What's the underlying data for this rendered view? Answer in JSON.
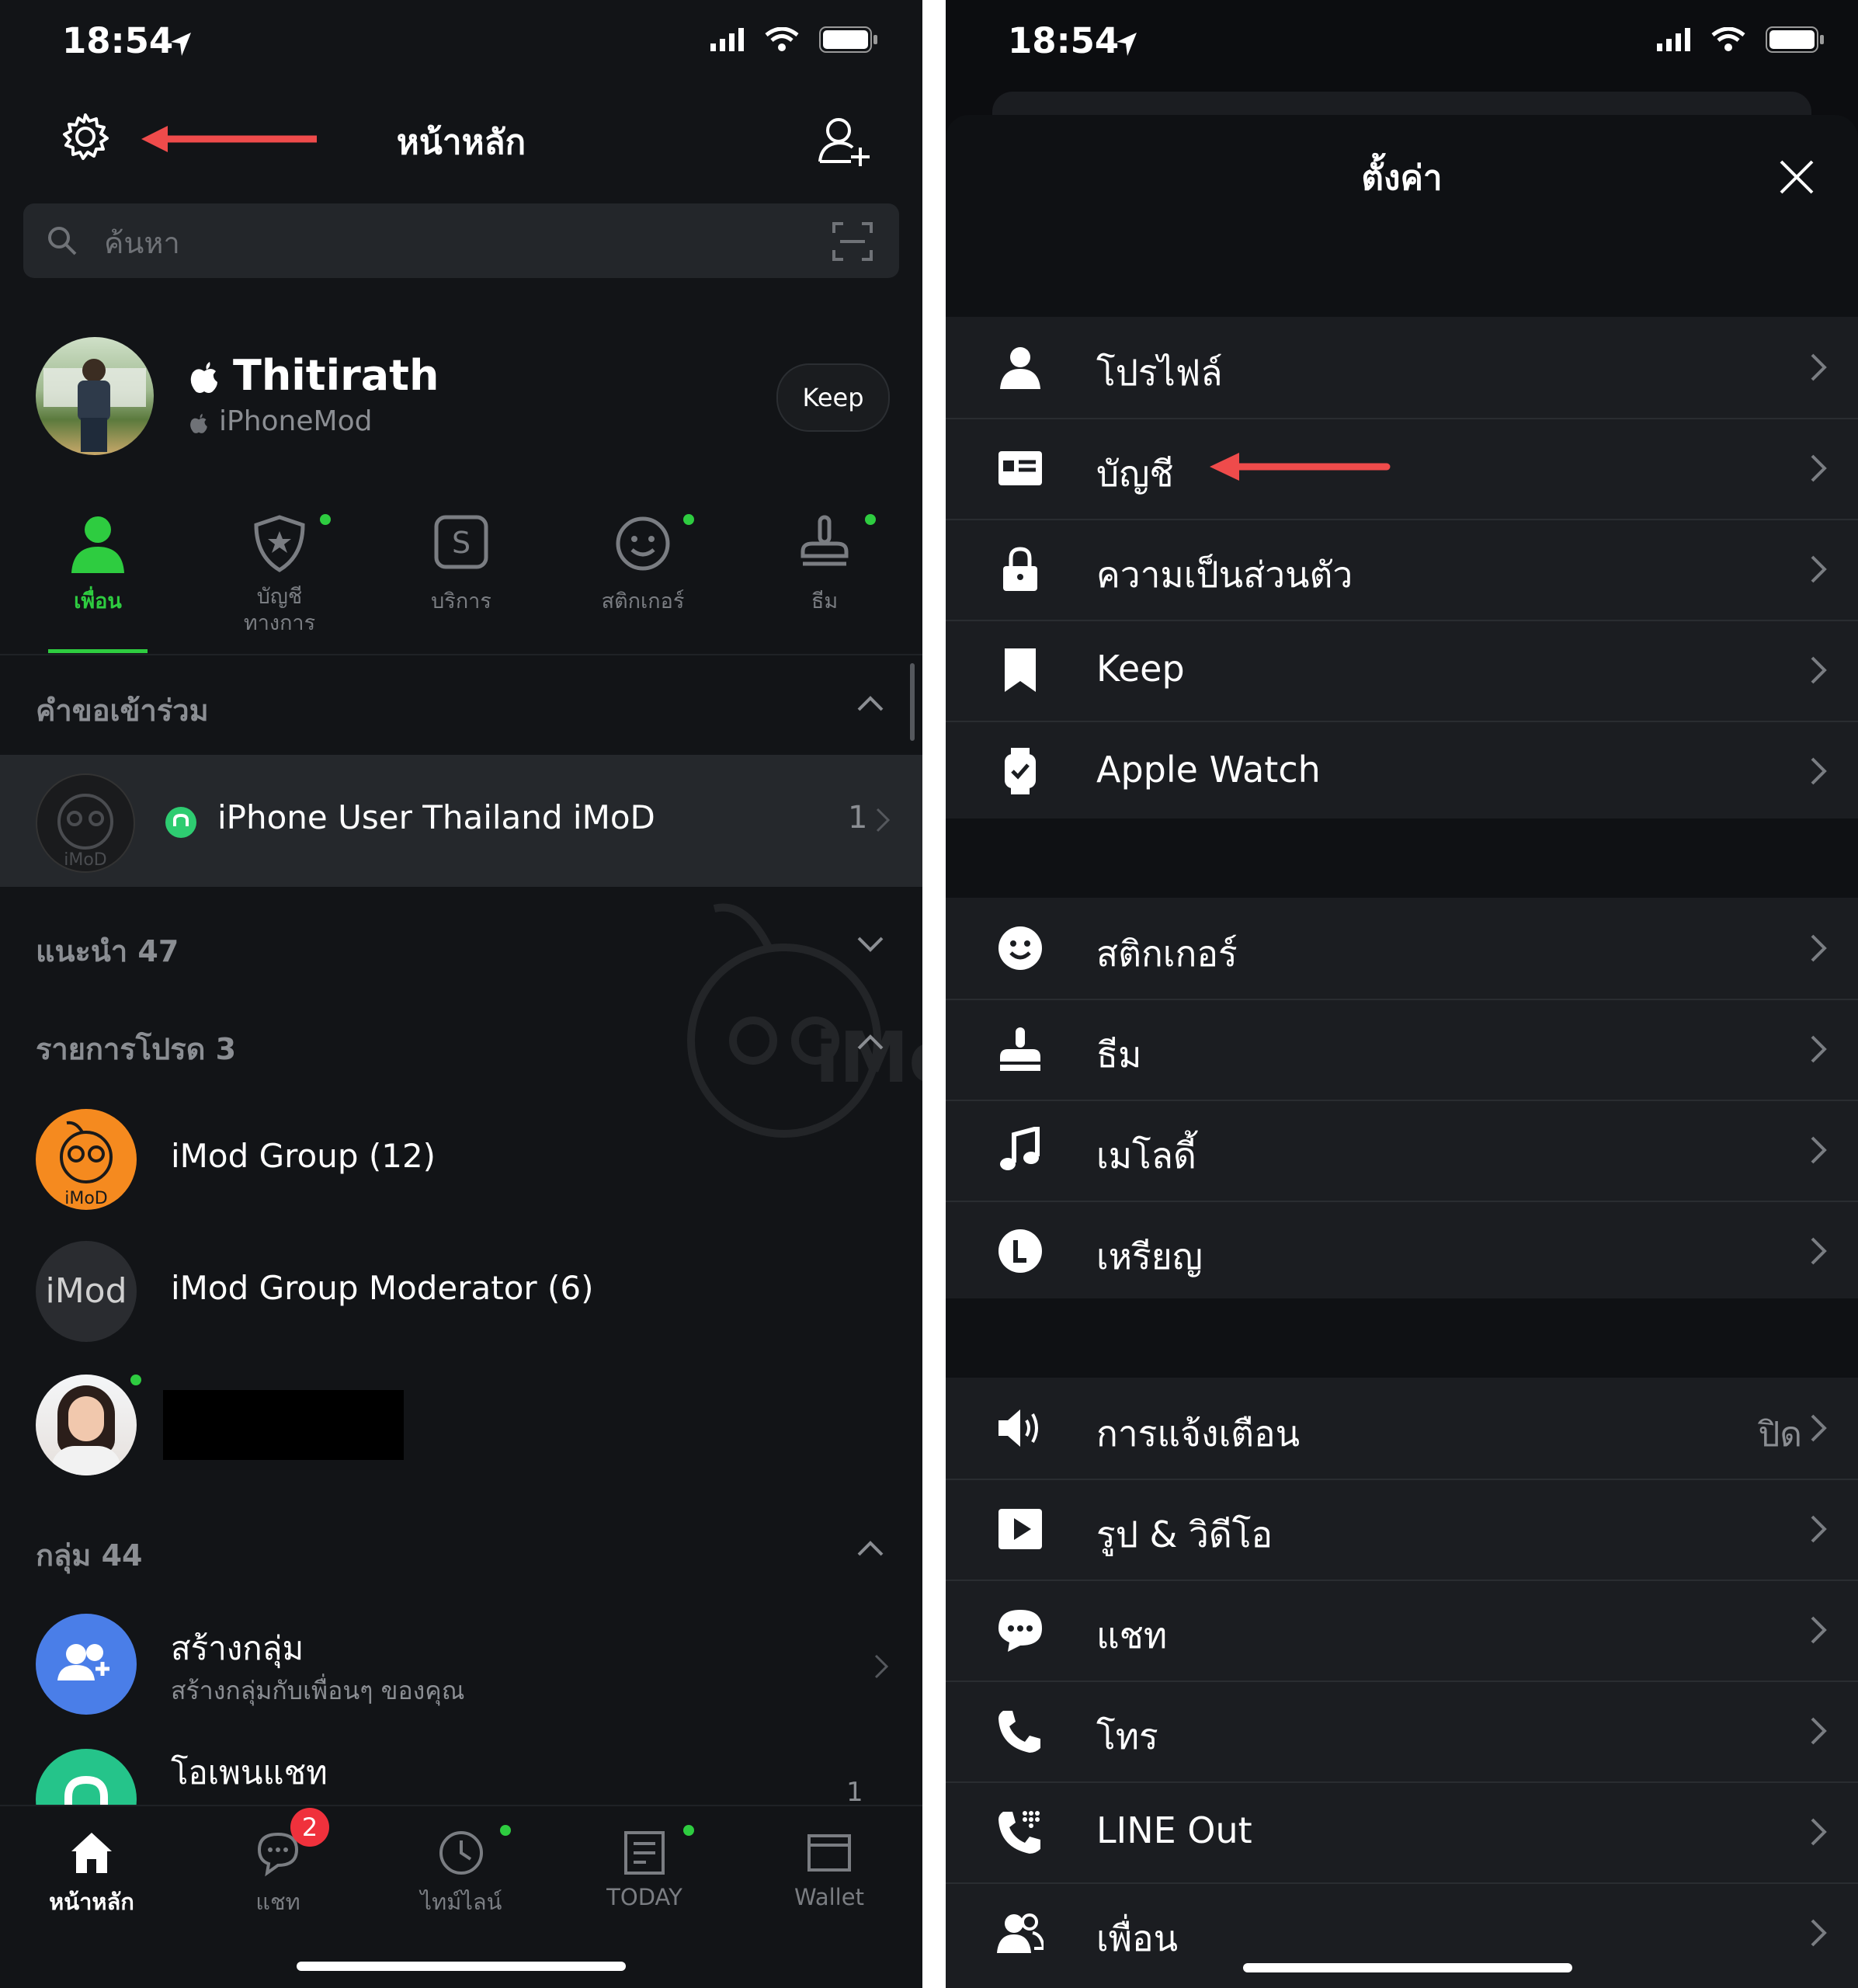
{
  "status": {
    "time": "18:54"
  },
  "left": {
    "header": {
      "title": "หน้าหลัก"
    },
    "search": {
      "placeholder": "ค้นหา"
    },
    "profile": {
      "name": "Thitirath",
      "subtitle": "iPhoneMod",
      "keep_label": "Keep"
    },
    "tabs": [
      {
        "label": "เพื่อน",
        "icon": "person-icon",
        "active": true
      },
      {
        "label_1": "บัญชี",
        "label_2": "ทางการ",
        "icon": "shield-star-icon"
      },
      {
        "label": "บริการ",
        "icon": "service-s-icon"
      },
      {
        "label": "สติกเกอร์",
        "icon": "smiley-icon"
      },
      {
        "label": "ธีม",
        "icon": "brush-icon"
      }
    ],
    "sections": {
      "requests": {
        "title": "คำขอเข้าร่วม",
        "item_name": "iPhone User Thailand iMoD",
        "item_count": "1",
        "avatar_text": "iMoD"
      },
      "recommended": {
        "title": "แนะนำ 47"
      },
      "favorites": {
        "title": "รายการโปรด 3",
        "items": [
          {
            "name": "iMod Group  (12)",
            "avatar_text": "iMoD"
          },
          {
            "name": "iMod Group Moderator  (6)",
            "avatar_text": "iMod"
          }
        ]
      },
      "groups": {
        "title": "กลุ่ม 44",
        "create": {
          "title": "สร้างกลุ่ม",
          "subtitle": "สร้างกลุ่มกับเพื่อนๆ ของคุณ"
        },
        "open_chat": {
          "title": "โอเพนแชท",
          "count": "1"
        }
      }
    },
    "bottom_nav": [
      {
        "label": "หน้าหลัก",
        "icon": "home-icon",
        "active": true
      },
      {
        "label": "แชท",
        "icon": "chat-icon",
        "badge": "2"
      },
      {
        "label": "ไทม์ไลน์",
        "icon": "clock-icon"
      },
      {
        "label": "TODAY",
        "icon": "news-icon"
      },
      {
        "label": "Wallet",
        "icon": "wallet-icon"
      }
    ],
    "watermark": "iMoD"
  },
  "right": {
    "header": {
      "title": "ตั้งค่า"
    },
    "groups": [
      [
        {
          "label": "โปรไฟล์",
          "icon": "person-icon"
        },
        {
          "label": "บัญชี",
          "icon": "id-card-icon"
        },
        {
          "label": "ความเป็นส่วนตัว",
          "icon": "lock-icon"
        },
        {
          "label": "Keep",
          "icon": "bookmark-icon"
        },
        {
          "label": "Apple Watch",
          "icon": "watch-icon"
        }
      ],
      [
        {
          "label": "สติกเกอร์",
          "icon": "smiley-icon"
        },
        {
          "label": "ธีม",
          "icon": "brush-icon"
        },
        {
          "label": "เมโลดี้",
          "icon": "music-note-icon"
        },
        {
          "label": "เหรียญ",
          "icon": "coin-icon"
        }
      ],
      [
        {
          "label": "การแจ้งเตือน",
          "icon": "speaker-icon",
          "value": "ปิด"
        },
        {
          "label": "รูป & วิดีโอ",
          "icon": "play-icon"
        },
        {
          "label": "แชท",
          "icon": "chat-bubble-icon"
        },
        {
          "label": "โทร",
          "icon": "phone-icon"
        },
        {
          "label": "LINE Out",
          "icon": "phone-keypad-icon"
        },
        {
          "label": "เพื่อน",
          "icon": "friends-icon"
        }
      ]
    ]
  },
  "colors": {
    "accent_green": "#2ecc40",
    "arrow_red": "#ef4b4b",
    "badge_red": "#f0313c",
    "bg_dark": "#121417"
  }
}
